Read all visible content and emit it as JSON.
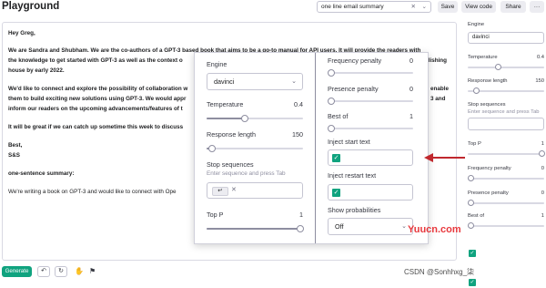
{
  "header": {
    "title": "Playground",
    "preset_value": "one line email summary",
    "save_label": "Save",
    "view_code_label": "View code",
    "share_label": "Share",
    "more_label": "···"
  },
  "editor": {
    "greeting": "Hey Greg,",
    "para1_line1": "We are Sandra and Shubham. We are the co-authors of a GPT-3 based book that aims to be a go-to manual for API users. It will provide the readers with",
    "para1_line2": "the knowledge to get started with GPT-3 as well as the context o",
    "para1_line2_tail": "ublishing",
    "para1_line3": "house by early 2022.",
    "para2_line1": "We'd like to connect and explore the possibility of collaboration w",
    "para2_line1_tail": "enable",
    "para2_line2": "them to build exciting new solutions using GPT-3. We would appr",
    "para2_line2_tail": "3 and",
    "para2_line3": "inform our readers on the upcoming advancements/features of t",
    "para3": "It will be great if we can catch up sometime this week to discuss",
    "signoff": "Best,",
    "signature": "S&S",
    "summary_label": "one-sentence summary:",
    "summary_text": "We're writing a book on GPT-3 and would like to connect with Ope"
  },
  "footer": {
    "generate_label": "Generate"
  },
  "sidebar": {
    "engine_label": "Engine",
    "engine_value": "davinci",
    "temperature_label": "Temperature",
    "temperature_value": "0.4",
    "response_length_label": "Response length",
    "response_length_value": "150",
    "stop_label": "Stop sequences",
    "stop_hint": "Enter sequence and press Tab",
    "top_p_label": "Top P",
    "top_p_value": "1",
    "frequency_penalty_label": "Frequency penalty",
    "frequency_penalty_value": "0",
    "presence_penalty_label": "Presence penalty",
    "presence_penalty_value": "0",
    "best_of_label": "Best of",
    "best_of_value": "1"
  },
  "popup": {
    "engine_label": "Engine",
    "engine_value": "davinci",
    "temperature_label": "Temperature",
    "temperature_value": "0.4",
    "temperature_level": 0.4,
    "response_length_label": "Response length",
    "response_length_value": "150",
    "stop_label": "Stop sequences",
    "stop_hint": "Enter sequence and press Tab",
    "stop_chip": "↵",
    "top_p_label": "Top P",
    "top_p_value": "1",
    "frequency_penalty_label": "Frequency penalty",
    "frequency_penalty_value": "0",
    "presence_penalty_label": "Presence penalty",
    "presence_penalty_value": "0",
    "best_of_label": "Best of",
    "best_of_value": "1",
    "inject_start_label": "Inject start text",
    "inject_restart_label": "Inject restart text",
    "show_probabilities_label": "Show probabilities",
    "show_probabilities_value": "Off"
  },
  "watermarks": {
    "brand": "Yuucn.com",
    "credit": "CSDN @Sonhhxg_柒"
  },
  "colors": {
    "accent": "#10a37f",
    "arrow": "#c0282e"
  }
}
